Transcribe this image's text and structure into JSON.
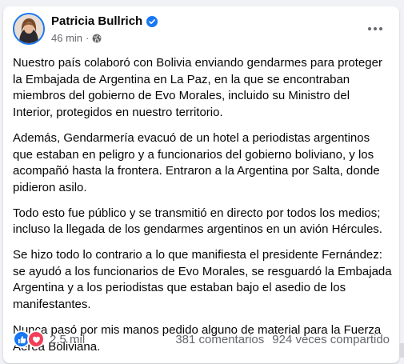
{
  "post": {
    "author": "Patricia Bullrich",
    "time": "46 min",
    "time_separator": "·",
    "icons": {
      "verified": "verified-badge-icon",
      "audience": "globe-icon",
      "more": "more-options-icon"
    },
    "paragraphs": [
      "Nuestro país colaboró con Bolivia enviando gendarmes para proteger la Embajada de Argentina en La Paz, en la que se encontraban miembros del gobierno de Evo Morales, incluido su Ministro del Interior, protegidos en nuestro territorio.",
      "Además, Gendarmería evacuó de un hotel a periodistas argentinos que estaban en peligro y a funcionarios del gobierno boliviano, y los acompañó hasta la frontera. Entraron a la Argentina por Salta, donde pidieron asilo.",
      "Todo esto fue público y se transmitió en directo por todos los medios; incluso la llegada de los gendarmes argentinos en un avión Hércules.",
      "Se hizo todo lo contrario a lo que manifiesta el presidente Fernández: se ayudó a los funcionarios de Evo Morales, se resguardó la Embajada Argentina y a los periodistas que estaban bajo el asedio de los manifestantes.",
      "Nunca pasó por mis manos pedido alguno de material para la Fuerza Aérea Boliviana."
    ]
  },
  "footer": {
    "reaction_icons": [
      "like-icon",
      "love-icon"
    ],
    "reaction_count": "2,5 mil",
    "comments": "381 comentarios",
    "shares": "924 veces compartido"
  },
  "colors": {
    "brand_blue": "#1877f2",
    "love_red": "#f33e58",
    "text_primary": "#050505",
    "text_secondary": "#65676b"
  }
}
